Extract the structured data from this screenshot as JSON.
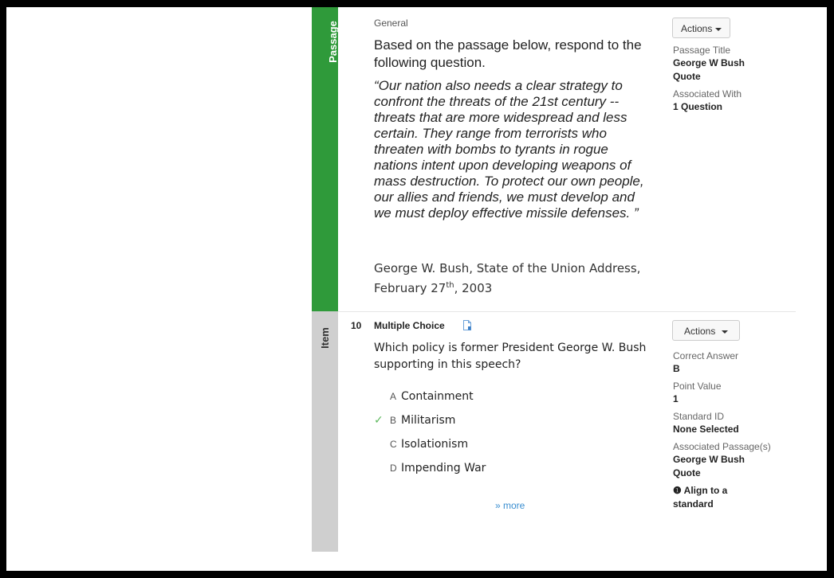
{
  "passage": {
    "strip_label": "Passage",
    "type": "General",
    "prompt": "Based on the passage below, respond to the following question.",
    "quote": "“Our nation also needs a clear strategy to confront the threats of the 21st century -- threats that are more widespread and less certain. They range from terrorists who threaten with bombs to tyrants in rogue nations intent upon developing weapons of mass destruction. To protect our own people, our allies and friends, we must develop and we must deploy effective missile defenses. ”",
    "source_line1": "George W. Bush, State of the Union Address,",
    "source_date_prefix": "February 27",
    "source_date_sup": "th",
    "source_date_suffix": ", 2003",
    "actions_label": "Actions",
    "meta": {
      "title_label": "Passage Title",
      "title_value": "George W Bush Quote",
      "associated_label": "Associated With",
      "associated_value": "1 Question"
    }
  },
  "item": {
    "strip_label": "Item",
    "number": "10",
    "type": "Multiple Choice",
    "question": "Which policy is former President George W. Bush supporting in this speech?",
    "choices": [
      {
        "letter": "A",
        "text": "Containment",
        "correct": false
      },
      {
        "letter": "B",
        "text": "Militarism",
        "correct": true
      },
      {
        "letter": "C",
        "text": "Isolationism",
        "correct": false
      },
      {
        "letter": "D",
        "text": "Impending War",
        "correct": false
      }
    ],
    "check_glyph": "✓",
    "more_label": "» more",
    "actions_label": "Actions",
    "meta": {
      "correct_label": "Correct Answer",
      "correct_value": "B",
      "points_label": "Point Value",
      "points_value": "1",
      "standard_label": "Standard ID",
      "standard_value": "None Selected",
      "assoc_label": "Associated Passage(s)",
      "assoc_value": "George W Bush Quote",
      "align_icon": "❶",
      "align_label": "Align to a standard"
    }
  },
  "colors": {
    "passage_strip": "#2f9a3a",
    "item_strip": "#cfcfcf",
    "link": "#3a8ed0",
    "check": "#5cb85c"
  }
}
